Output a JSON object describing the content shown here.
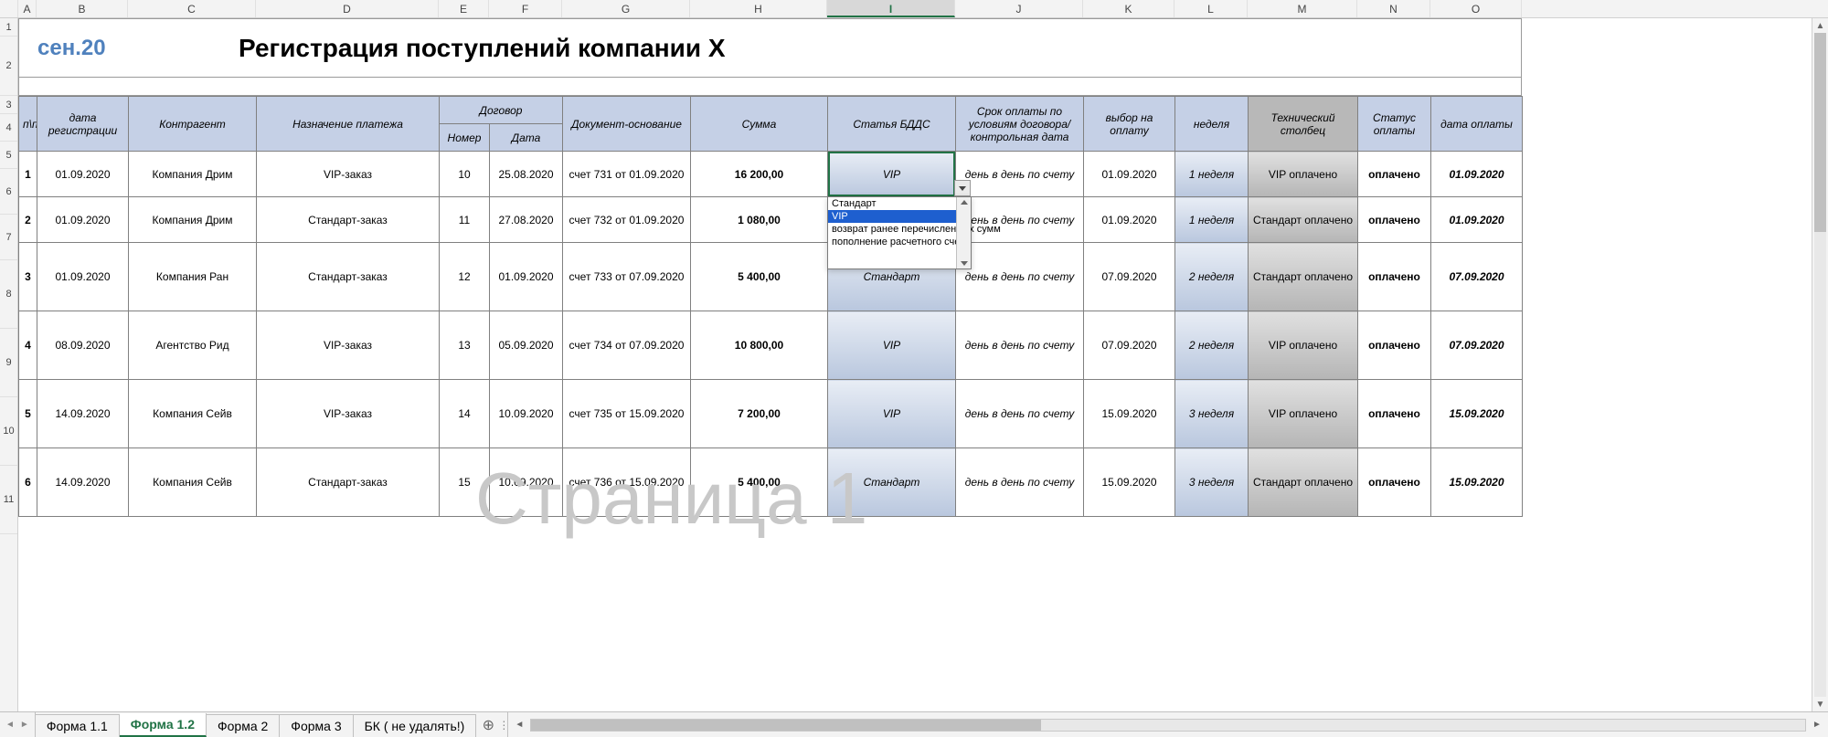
{
  "period": "сен.20",
  "title": "Регистрация поступлений компании Х",
  "watermark": "Страница 1",
  "column_letters": [
    "A",
    "B",
    "C",
    "D",
    "E",
    "F",
    "G",
    "H",
    "I",
    "J",
    "K",
    "L",
    "M",
    "N",
    "O"
  ],
  "row_numbers": [
    "1",
    "2",
    "3",
    "4",
    "5",
    "6",
    "7",
    "8",
    "9",
    "10",
    "11"
  ],
  "active_column": "I",
  "headers": {
    "pp": "п\\п",
    "reg_date": "дата регистрации",
    "counterparty": "Контрагент",
    "purpose": "Назначение платежа",
    "contract": "Договор",
    "contract_num": "Номер",
    "contract_date": "Дата",
    "basis": "Документ-основание",
    "sum": "Сумма",
    "bdds": "Статья БДДС",
    "term": "Срок оплаты по условиям договора/ контрольная дата",
    "choice": "выбор на оплату",
    "week": "неделя",
    "tech": "Технический столбец",
    "status": "Статус оплаты",
    "pay_date": "дата оплаты"
  },
  "dropdown": {
    "options": [
      "Стандарт",
      "VIP",
      "возврат ранее перечисленных сумм",
      "пополнение расчетного счета"
    ],
    "selected": "VIP"
  },
  "rows": [
    {
      "n": "1",
      "reg": "01.09.2020",
      "cp": "Компания Дрим",
      "purpose": "VIP-заказ",
      "cnum": "10",
      "cdate": "25.08.2020",
      "basis": "счет 731 от 01.09.2020",
      "sum": "16 200,00",
      "bdds": "VIP",
      "term": "день в день по счету",
      "choice": "01.09.2020",
      "week": "1 неделя",
      "tech": "VIP оплачено",
      "status": "оплачено",
      "pdate": "01.09.2020"
    },
    {
      "n": "2",
      "reg": "01.09.2020",
      "cp": "Компания Дрим",
      "purpose": "Стандарт-заказ",
      "cnum": "11",
      "cdate": "27.08.2020",
      "basis": "счет 732 от 01.09.2020",
      "sum": "1 080,00",
      "bdds": "",
      "term": "день в день по счету",
      "choice": "01.09.2020",
      "week": "1 неделя",
      "tech": "Стандарт оплачено",
      "status": "оплачено",
      "pdate": "01.09.2020"
    },
    {
      "n": "3",
      "reg": "01.09.2020",
      "cp": "Компания Ран",
      "purpose": "Стандарт-заказ",
      "cnum": "12",
      "cdate": "01.09.2020",
      "basis": "счет 733 от 07.09.2020",
      "sum": "5 400,00",
      "bdds": "Стандарт",
      "term": "день в день по счету",
      "choice": "07.09.2020",
      "week": "2 неделя",
      "tech": "Стандарт оплачено",
      "status": "оплачено",
      "pdate": "07.09.2020"
    },
    {
      "n": "4",
      "reg": "08.09.2020",
      "cp": "Агентство Рид",
      "purpose": "VIP-заказ",
      "cnum": "13",
      "cdate": "05.09.2020",
      "basis": "счет 734 от 07.09.2020",
      "sum": "10 800,00",
      "bdds": "VIP",
      "term": "день в день по счету",
      "choice": "07.09.2020",
      "week": "2 неделя",
      "tech": "VIP оплачено",
      "status": "оплачено",
      "pdate": "07.09.2020"
    },
    {
      "n": "5",
      "reg": "14.09.2020",
      "cp": "Компания Сейв",
      "purpose": "VIP-заказ",
      "cnum": "14",
      "cdate": "10.09.2020",
      "basis": "счет 735 от 15.09.2020",
      "sum": "7 200,00",
      "bdds": "VIP",
      "term": "день в день по счету",
      "choice": "15.09.2020",
      "week": "3 неделя",
      "tech": "VIP оплачено",
      "status": "оплачено",
      "pdate": "15.09.2020"
    },
    {
      "n": "6",
      "reg": "14.09.2020",
      "cp": "Компания Сейв",
      "purpose": "Стандарт-заказ",
      "cnum": "15",
      "cdate": "10.09.2020",
      "basis": "счет 736 от 15.09.2020",
      "sum": "5 400,00",
      "bdds": "Стандарт",
      "term": "день в день по счету",
      "choice": "15.09.2020",
      "week": "3 неделя",
      "tech": "Стандарт оплачено",
      "status": "оплачено",
      "pdate": "15.09.2020"
    }
  ],
  "tabs": [
    "Форма 1.1",
    "Форма 1.2",
    "Форма 2",
    "Форма 3",
    "БК ( не удалять!)"
  ],
  "active_tab": "Форма 1.2",
  "col_widths": {
    "rownum": 20,
    "A": 20,
    "B": 100,
    "C": 140,
    "D": 200,
    "E": 55,
    "F": 80,
    "G": 140,
    "H": 150,
    "I": 140,
    "J": 140,
    "K": 100,
    "L": 80,
    "M": 120,
    "N": 80,
    "O": 100
  },
  "row_heights": {
    "1": 20,
    "2": 65,
    "3": 20,
    "4": 30,
    "5": 30,
    "6": 50,
    "7": 50,
    "8": 75,
    "9": 75,
    "10": 75,
    "11": 75
  }
}
